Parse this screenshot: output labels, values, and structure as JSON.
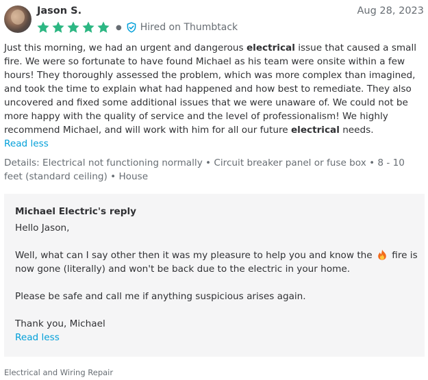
{
  "reviewer": {
    "name": "Jason S.",
    "date": "Aug 28, 2023",
    "rating": 5,
    "hired_label": "Hired on Thumbtack"
  },
  "review": {
    "segments": [
      "Just this morning, we had an urgent and dangerous ",
      "electrical",
      " issue that caused a small fire. We were so fortunate to have found Michael as his team were onsite within a few hours! They thoroughly assessed the problem, which was more complex than imagined, and took the time to explain what had happened and how best to remediate. They also uncovered and fixed some additional issues that we were unaware of. We could not be more happy with the quality of service and the level of professionalism! We highly recommend Michael, and will work with him for all our future ",
      "electrical",
      " needs."
    ],
    "read_less": "Read less",
    "details": "Details: Electrical not functioning normally • Circuit breaker panel or fuse box • 8 - 10 feet (standard ceiling) • House"
  },
  "reply": {
    "title": "Michael Electric's reply",
    "greeting": "Hello Jason,",
    "para1_before": "Well, what can I say other then it was my pleasure to help you and know the ",
    "para1_after": " fire is now gone (literally) and won't be back due to the electric in your home.",
    "para2": "Please be safe and call me if anything suspicious arises again.",
    "signoff": "Thank you, Michael",
    "read_less": "Read less"
  },
  "category": "Electrical and Wiring Repair",
  "colors": {
    "star": "#2db783",
    "link": "#009fd9",
    "check": "#009fd9",
    "text": "#2f3033",
    "muted": "#676d73",
    "reply_bg": "#f5f5f6"
  }
}
